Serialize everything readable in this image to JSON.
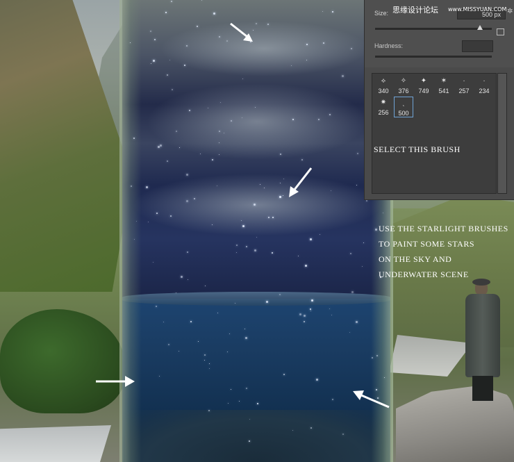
{
  "brush_panel": {
    "size_label": "Size:",
    "size_value": "500 px",
    "hardness_label": "Hardness:",
    "size_slider_fraction": 0.9,
    "watermark": "思缘设计论坛",
    "watermark_url": "www.MISSYUAN.COM",
    "gear_icon": "gear-icon",
    "new_preset_icon": "new-preset-icon",
    "brushes_row1": [
      {
        "glyph": "⟡",
        "size": "340"
      },
      {
        "glyph": "✧",
        "size": "376"
      },
      {
        "glyph": "✦",
        "size": "749"
      },
      {
        "glyph": "✶",
        "size": "541"
      },
      {
        "glyph": "·",
        "size": "257"
      },
      {
        "glyph": "·",
        "size": "234"
      }
    ],
    "brushes_row2": [
      {
        "glyph": "✷",
        "size": "256"
      },
      {
        "glyph": "ˎ",
        "size": "500"
      }
    ],
    "selected_brush_index": 7
  },
  "instructions": {
    "select_brush": "SELECT THIS BRUSH",
    "paint_lines": [
      "USE THE STARLIGHT BRUSHES",
      "TO PAINT SOME STARS",
      "ON THE SKY AND",
      "UNDERWATER SCENE"
    ]
  },
  "colors": {
    "panel_bg": "#4a4a4a",
    "selection_border": "#6fa3d6",
    "arrow": "#ffffff"
  }
}
